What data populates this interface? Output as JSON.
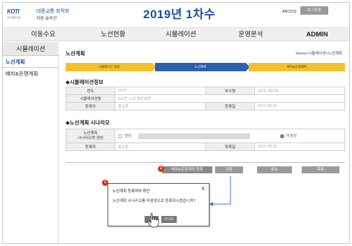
{
  "header": {
    "logo_text": "KOTI",
    "logo_sub": "한국교통연구원",
    "org_name": "대중교통 최적화",
    "org_sub": "지원 솔루션",
    "title": "2019년 1차수",
    "user": "ABCD님",
    "logout": "로그아웃"
  },
  "topnav": [
    "이동수요",
    "노선현황",
    "시뮬레이션",
    "운영분석",
    "ADMIN"
  ],
  "sidebar": {
    "heading": "시뮬레이션",
    "items": [
      "노선계획",
      "배차&운행계획"
    ]
  },
  "main": {
    "title": "노선계획",
    "breadcrumb": "Home>시뮬레이션>노선계획",
    "steps": [
      "시뮬레이션 생성",
      "노선계획",
      "배차&운행계획"
    ]
  },
  "sim_info": {
    "section_title": "◆시뮬레이션정보",
    "rows": [
      {
        "label1": "연도",
        "value1": "2019",
        "label2": "차수명",
        "value2": "2차수 페이퍼"
      },
      {
        "label1": "시뮬레이션명",
        "value1": "111번 노선 대안생성",
        "label2": "",
        "value2": ""
      },
      {
        "label1": "등록자",
        "value1": "홍길동",
        "label2": "등록일",
        "value2": "2019.08.30"
      }
    ]
  },
  "scenario": {
    "section_title": "◆노선계획 시나리오",
    "gen_label_1": "노선계획",
    "gen_label_2": "시나리오명 생성",
    "opt_generated": "생성",
    "opt_not_generated": "미생성",
    "reg_label": "등록자",
    "reg_value": "홍길동",
    "date_label": "등록일",
    "date_value": "2019.08.30"
  },
  "buttons": {
    "register_schedule": "배차&운행계획 등록",
    "save": "저장",
    "cancel": "취소",
    "list": "목록",
    "badge_register": "2",
    "badge_popup": "1"
  },
  "popup": {
    "title": "노선계획 등록여부 확인",
    "close": "X",
    "message": "노선계획 시나리오를 미생성으로 등록하시겠습니까?",
    "yes": "네",
    "no": "아니오"
  },
  "colors": {
    "brand_blue": "#1c4fa0",
    "step_yellow": "#f3c12b",
    "step_active": "#2c5fb1",
    "badge_red": "#d6301e",
    "button_gray": "#9a9a9a",
    "callout_blue": "#3a6fd0"
  }
}
